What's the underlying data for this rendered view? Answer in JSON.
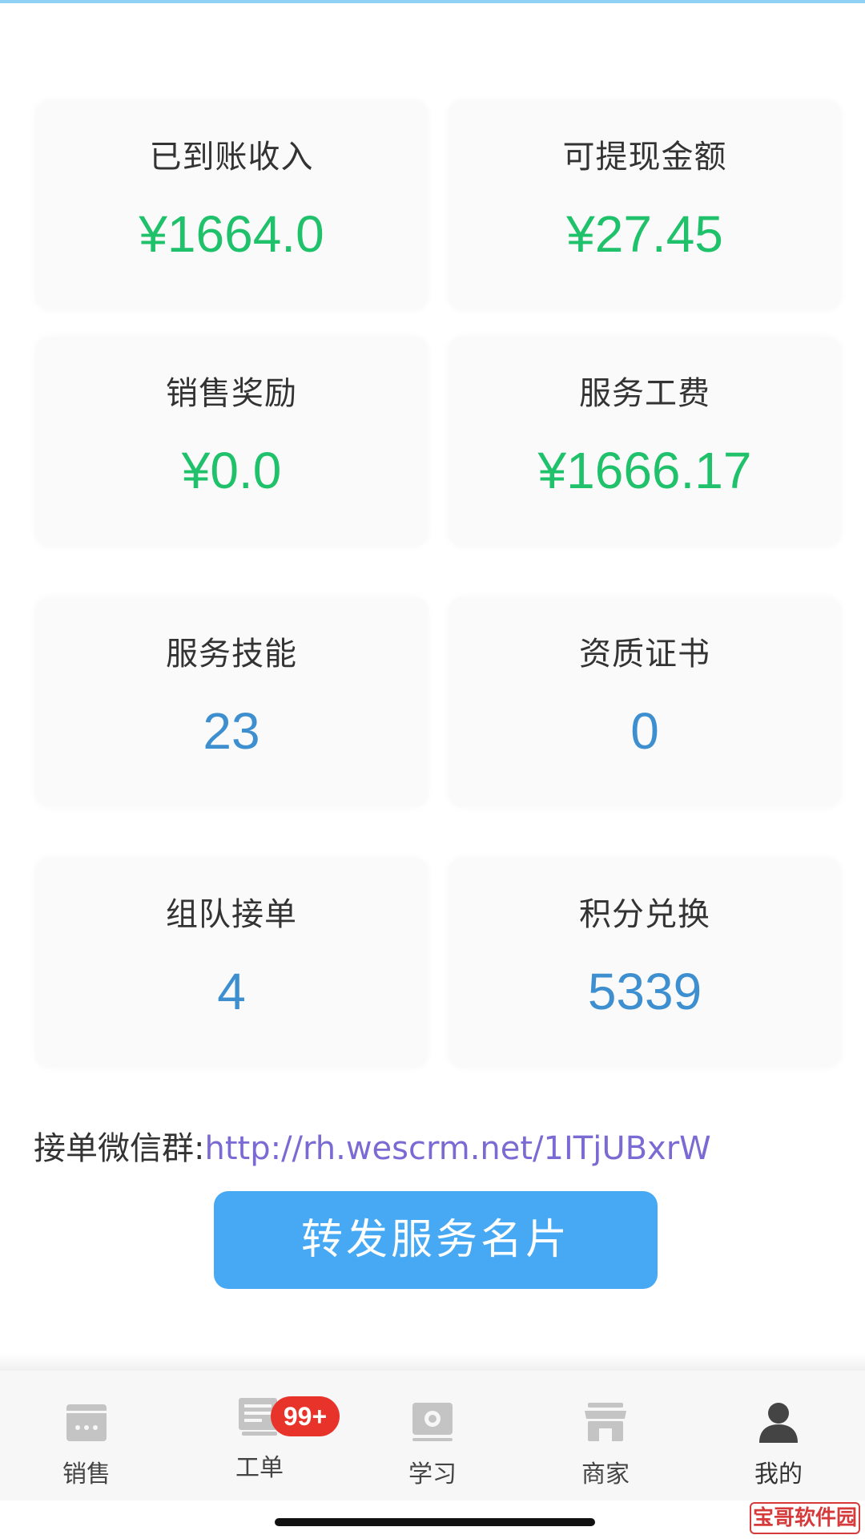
{
  "stats": [
    {
      "label": "已到账收入",
      "value": "¥1664.0"
    },
    {
      "label": "可提现金额",
      "value": "¥27.45"
    },
    {
      "label": "销售奖励",
      "value": "¥0.0"
    },
    {
      "label": "服务工费",
      "value": "¥1666.17"
    },
    {
      "label": "服务技能",
      "value": "23"
    },
    {
      "label": "资质证书",
      "value": "0"
    },
    {
      "label": "组队接单",
      "value": "4"
    },
    {
      "label": "积分兑换",
      "value": "5339"
    }
  ],
  "group": {
    "label": "接单微信群:",
    "link": "http://rh.wescrm.net/1ITjUBxrW"
  },
  "share_button": "转发服务名片",
  "tabs": [
    {
      "label": "销售",
      "icon": "sales-icon"
    },
    {
      "label": "工单",
      "icon": "work-order-icon"
    },
    {
      "label": "学习",
      "icon": "study-icon"
    },
    {
      "label": "商家",
      "icon": "store-icon"
    },
    {
      "label": "我的",
      "icon": "profile-icon"
    }
  ],
  "badge": "99+",
  "watermark": "宝哥软件园",
  "colors": {
    "money_green": "#1fc16b",
    "count_blue": "#3d8fd0",
    "button_blue": "#47a9f3",
    "badge_red": "#e8332b",
    "link_purple": "#7a6ad3"
  }
}
